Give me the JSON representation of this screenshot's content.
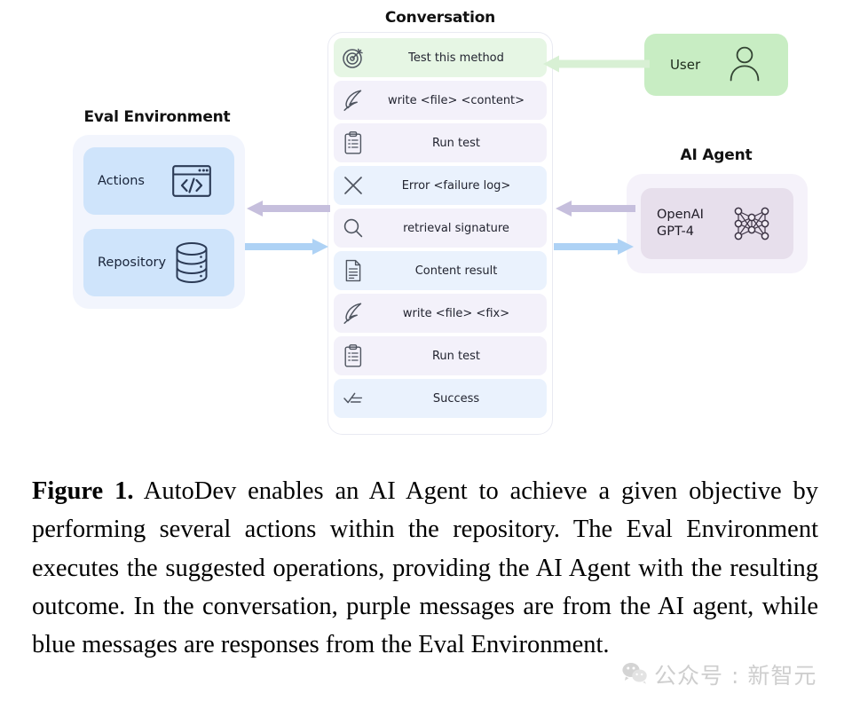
{
  "figure": {
    "eval_environment": {
      "title": "Eval Environment",
      "cards": [
        {
          "label": "Actions",
          "icon": "code-window-icon"
        },
        {
          "label": "Repository",
          "icon": "database-icon"
        }
      ]
    },
    "conversation": {
      "title": "Conversation",
      "messages": [
        {
          "text": "Test this method",
          "icon": "target-icon",
          "source": "user"
        },
        {
          "text": "write <file> <content>",
          "icon": "quill-icon",
          "source": "agent"
        },
        {
          "text": "Run test",
          "icon": "clipboard-icon",
          "source": "agent"
        },
        {
          "text": "Error <failure log>",
          "icon": "cross-icon",
          "source": "env"
        },
        {
          "text": "retrieval signature",
          "icon": "search-icon",
          "source": "agent"
        },
        {
          "text": "Content result",
          "icon": "document-icon",
          "source": "env"
        },
        {
          "text": "write <file> <fix>",
          "icon": "quill-icon",
          "source": "agent"
        },
        {
          "text": "Run test",
          "icon": "clipboard-icon",
          "source": "agent"
        },
        {
          "text": "Success",
          "icon": "checklist-icon",
          "source": "env"
        }
      ]
    },
    "user": {
      "label": "User",
      "icon": "person-icon"
    },
    "ai_agent": {
      "title": "AI Agent",
      "model_line1": "OpenAI",
      "model_line2": "GPT-4",
      "icon": "neural-network-icon"
    },
    "arrows": [
      {
        "name": "user-to-conversation-arrow",
        "direction": "left",
        "color": "#d8f0d4"
      },
      {
        "name": "agent-to-conversation-arrow",
        "direction": "left",
        "color": "#c6bfdd"
      },
      {
        "name": "conversation-to-agent-arrow",
        "direction": "right",
        "color": "#aed2f5"
      },
      {
        "name": "conversation-to-eval-arrow",
        "direction": "left",
        "color": "#c6bfdd"
      },
      {
        "name": "eval-to-conversation-arrow",
        "direction": "right",
        "color": "#aed2f5"
      }
    ],
    "colors": {
      "user_message": "#e6f6e4",
      "agent_message": "#f3f1fa",
      "env_message": "#eaf2fd",
      "eval_card": "#cfe4fb",
      "agent_card": "#e7dfec",
      "user_box": "#c8edc3",
      "purple_arrow": "#c6bfdd",
      "blue_arrow": "#aed2f5",
      "green_arrow": "#d8f0d4"
    }
  },
  "caption": {
    "label": "Figure 1.",
    "body": " AutoDev enables an AI Agent to achieve a given objective by performing several actions within the repository. The Eval Environment executes the suggested operations, providing the AI Agent with the resulting outcome. In the conversation, purple messages are from the AI agent, while blue messages are responses from the Eval Environment."
  },
  "watermark": {
    "text": "公众号 : 新智元",
    "icon": "wechat-icon"
  }
}
